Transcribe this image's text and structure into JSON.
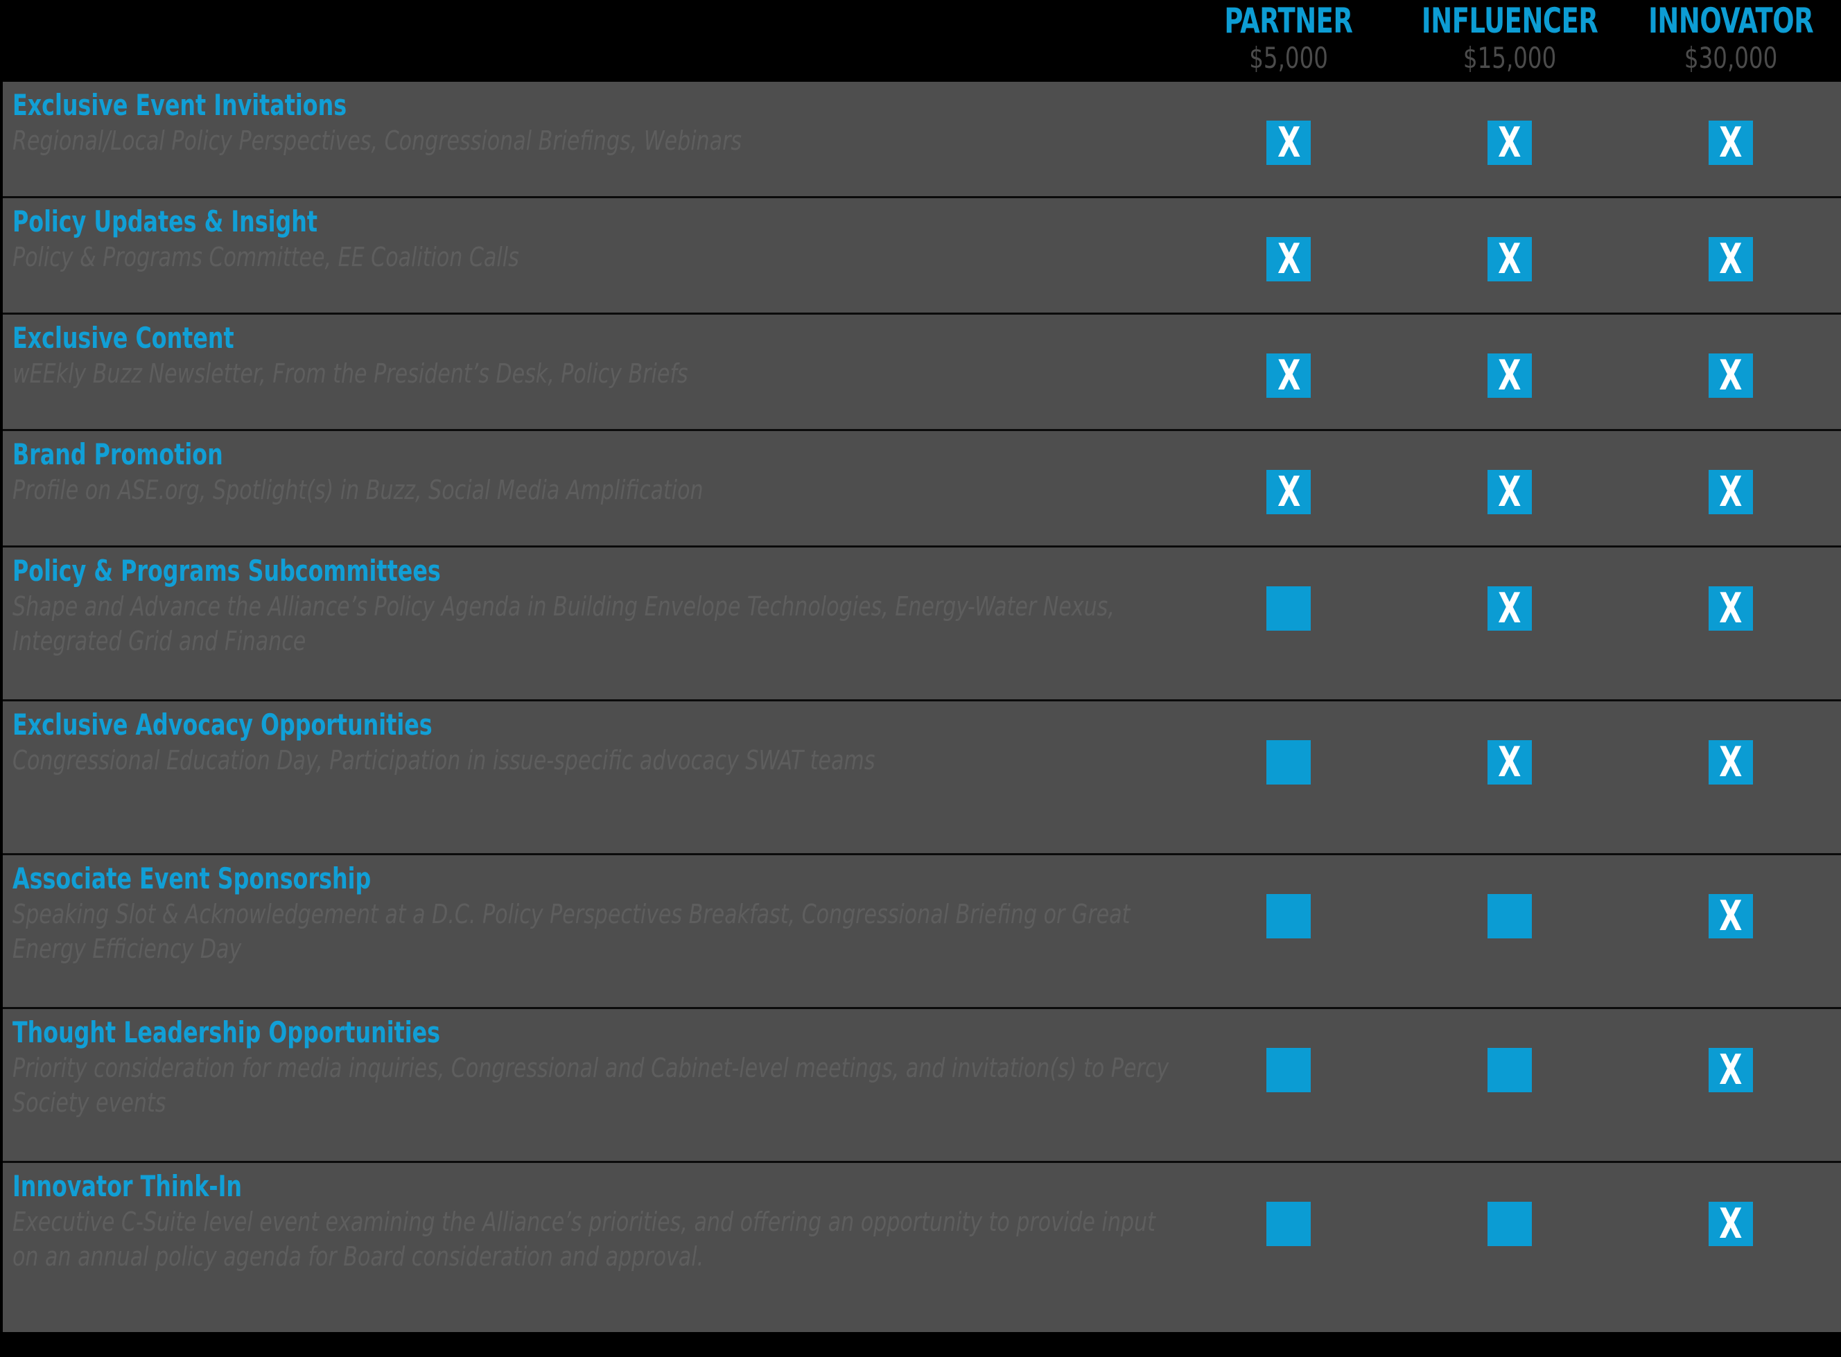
{
  "colors": {
    "accent_blue": "#0B9CD3",
    "title_blue": "#119FD6",
    "row_background": "#4e4e4e",
    "page_background": "#000000",
    "desc_gray": "#5e5e5e",
    "price_gray": "#4b4b4b",
    "mark_white": "#ffffff"
  },
  "header": {
    "tiers": [
      {
        "name": "PARTNER",
        "price": "$5,000"
      },
      {
        "name": "INFLUENCER",
        "price": "$15,000"
      },
      {
        "name": "INNOVATOR",
        "price": "$30,000"
      }
    ]
  },
  "mark_glyph": "X",
  "rows": [
    {
      "title": "Exclusive Event Invitations",
      "description": "Regional/Local Policy Perspectives, Congressional Briefings, Webinars",
      "desc_lines": 1,
      "marks": [
        "x",
        "x",
        "x"
      ]
    },
    {
      "title": "Policy Updates & Insight",
      "description": "Policy & Programs Committee, EE Coalition Calls",
      "desc_lines": 1,
      "marks": [
        "x",
        "x",
        "x"
      ]
    },
    {
      "title": "Exclusive Content",
      "description": "wEEkly Buzz Newsletter, From the President’s Desk, Policy Briefs",
      "desc_lines": 1,
      "marks": [
        "x",
        "x",
        "x"
      ]
    },
    {
      "title": "Brand Promotion",
      "description": "Profile on ASE.org, Spotlight(s) in Buzz, Social Media Amplification",
      "desc_lines": 1,
      "marks": [
        "x",
        "x",
        "x"
      ]
    },
    {
      "title": "Policy & Programs Subcommittees",
      "description": "Shape and Advance the Alliance’s Policy Agenda in Building Envelope Technologies, Energy-Water Nexus, Integrated Grid and Finance",
      "desc_lines": 2,
      "marks": [
        "empty",
        "x",
        "x"
      ]
    },
    {
      "title": "Exclusive Advocacy Opportunities",
      "description": "Congressional Education Day, Participation in issue-specific advocacy SWAT teams",
      "desc_lines": 2,
      "marks": [
        "empty",
        "x",
        "x"
      ]
    },
    {
      "title": "Associate Event Sponsorship",
      "description": "Speaking Slot & Acknowledgement at a D.C. Policy Perspectives Breakfast, Congressional Briefing or Great Energy Efficiency Day",
      "desc_lines": 2,
      "marks": [
        "empty",
        "empty",
        "x"
      ]
    },
    {
      "title": "Thought Leadership Opportunities",
      "description": "Priority consideration for media inquiries, Congressional and Cabinet-level meetings, and invitation(s) to Percy Society events",
      "desc_lines": 2,
      "marks": [
        "empty",
        "empty",
        "x"
      ]
    },
    {
      "title": "Innovator Think-In",
      "description": "Executive C-Suite level event examining the Alliance’s priorities, and offering an opportunity to provide input on an annual policy agenda for Board consideration and approval.",
      "desc_lines": 3,
      "marks": [
        "empty",
        "empty",
        "x"
      ]
    }
  ]
}
